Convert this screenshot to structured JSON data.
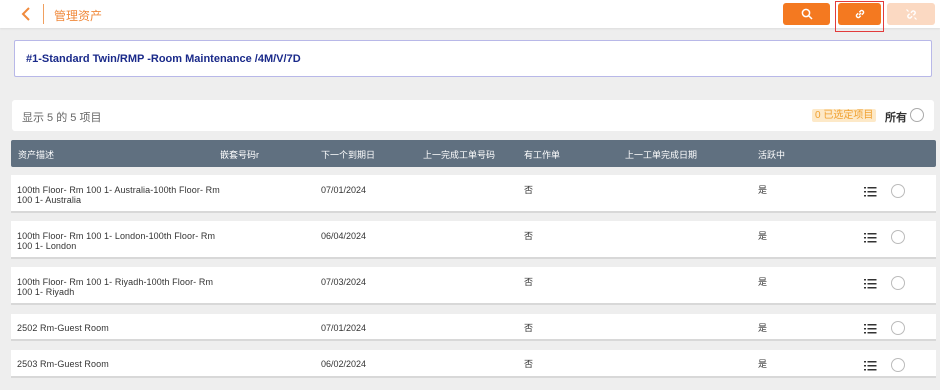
{
  "header": {
    "title": "管理资产",
    "buttons": {
      "search": "search-icon",
      "link": "link-icon",
      "unlink": "unlink-icon"
    },
    "accent": "#f47920"
  },
  "asset": {
    "title": "#1-Standard Twin/RMP -Room Maintenance /4M/V/7D"
  },
  "summary": {
    "text": "显示 5 的 5 项目",
    "selected": "0 已选定项目",
    "all_label": "所有"
  },
  "table": {
    "columns": [
      "资产描述",
      "嵌套号码r",
      "下一个到期日",
      "上一完成工单号码",
      "有工作单",
      "上一工单完成日期",
      "活跃中"
    ],
    "rows": [
      {
        "desc": "100th Floor- Rm 100 1- Australia-100th Floor- Rm 100 1- Australia",
        "due": "07/01/2024",
        "has_wo": "否",
        "active": "是"
      },
      {
        "desc": "100th Floor- Rm 100 1- London-100th Floor- Rm 100 1- London",
        "due": "06/04/2024",
        "has_wo": "否",
        "active": "是"
      },
      {
        "desc": "100th Floor- Rm 100 1- Riyadh-100th Floor- Rm 100 1- Riyadh",
        "due": "07/03/2024",
        "has_wo": "否",
        "active": "是"
      },
      {
        "desc": "2502 Rm-Guest Room",
        "due": "07/01/2024",
        "has_wo": "否",
        "active": "是"
      },
      {
        "desc": "2503 Rm-Guest Room",
        "due": "06/02/2024",
        "has_wo": "否",
        "active": "是"
      }
    ]
  }
}
